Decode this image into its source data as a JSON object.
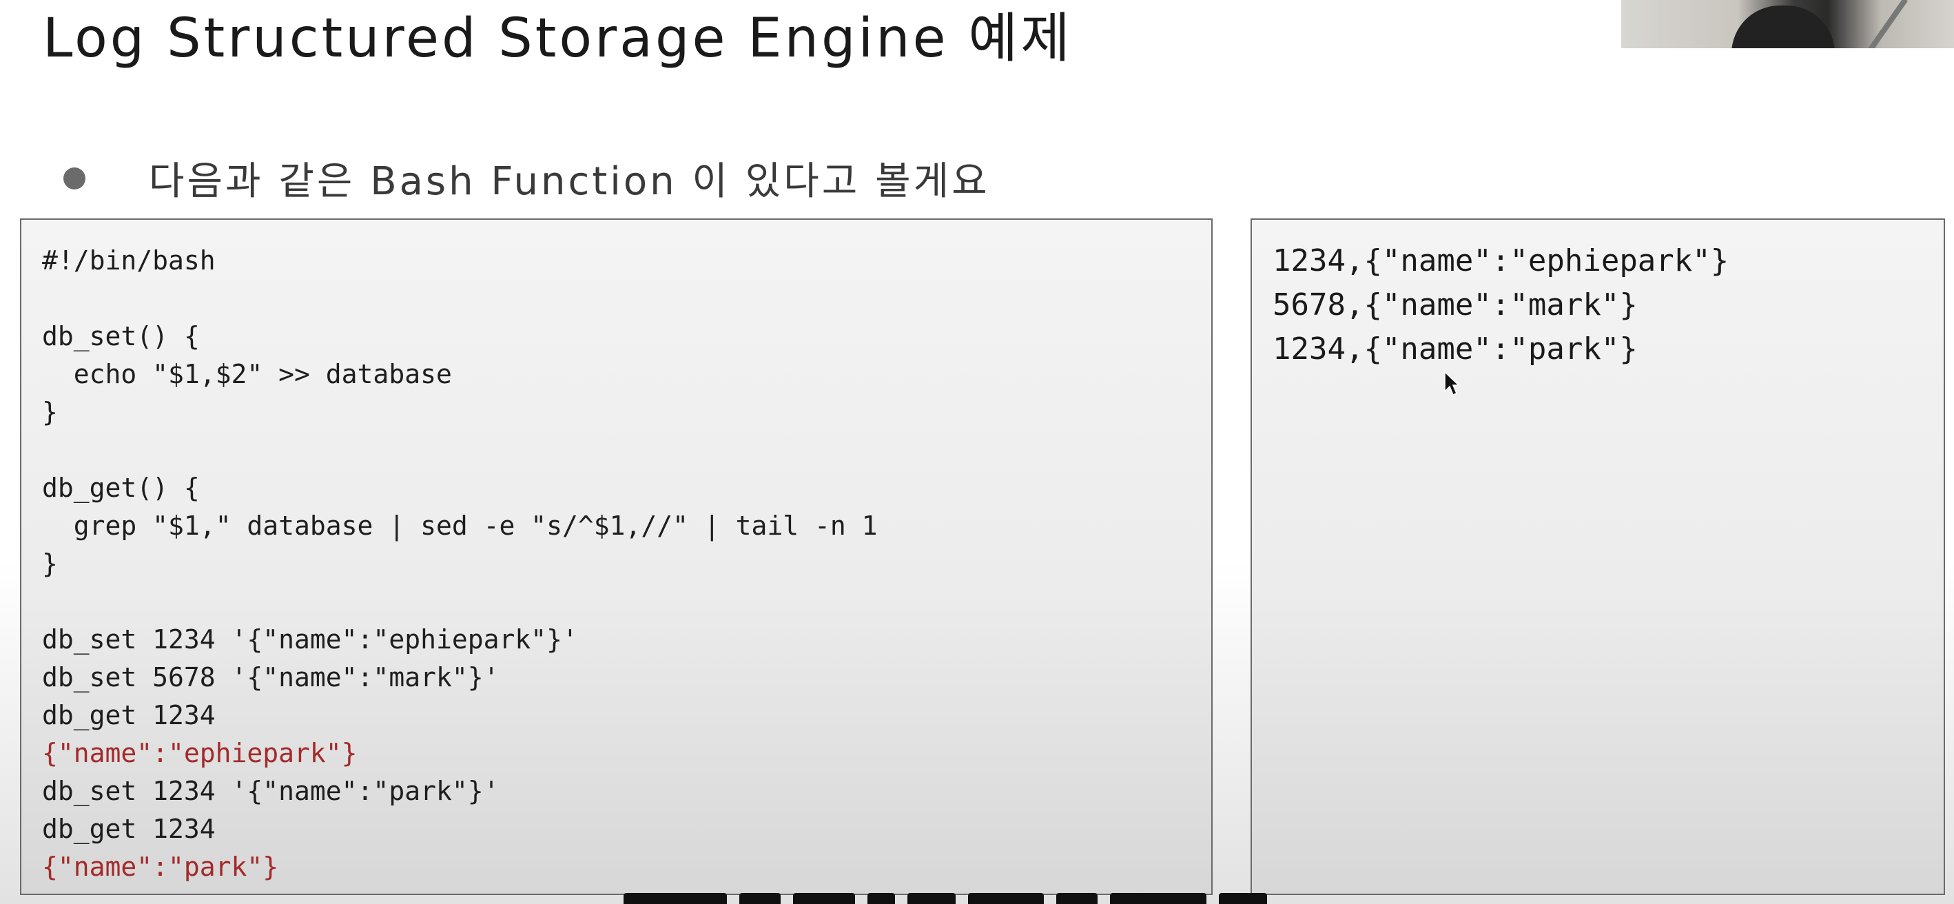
{
  "slide": {
    "title": "Log Structured Storage Engine 예제",
    "bullet": "다음과 같은 Bash Function 이 있다고 볼게요"
  },
  "code_panel": {
    "lines": [
      {
        "text": "#!/bin/bash",
        "kind": "code"
      },
      {
        "text": "",
        "kind": "code"
      },
      {
        "text": "db_set() {",
        "kind": "code"
      },
      {
        "text": "  echo \"$1,$2\" >> database",
        "kind": "code"
      },
      {
        "text": "}",
        "kind": "code"
      },
      {
        "text": "",
        "kind": "code"
      },
      {
        "text": "db_get() {",
        "kind": "code"
      },
      {
        "text": "  grep \"$1,\" database | sed -e \"s/^$1,//\" | tail -n 1",
        "kind": "code"
      },
      {
        "text": "}",
        "kind": "code"
      },
      {
        "text": "",
        "kind": "code"
      },
      {
        "text": "db_set 1234 '{\"name\":\"ephiepark\"}'",
        "kind": "code"
      },
      {
        "text": "db_set 5678 '{\"name\":\"mark\"}'",
        "kind": "code"
      },
      {
        "text": "db_get 1234",
        "kind": "code"
      },
      {
        "text": "{\"name\":\"ephiepark\"}",
        "kind": "output"
      },
      {
        "text": "db_set 1234 '{\"name\":\"park\"}'",
        "kind": "code"
      },
      {
        "text": "db_get 1234",
        "kind": "code"
      },
      {
        "text": "{\"name\":\"park\"}",
        "kind": "output"
      }
    ]
  },
  "database_panel": {
    "lines": [
      "1234,{\"name\":\"ephiepark\"}",
      "5678,{\"name\":\"mark\"}",
      "1234,{\"name\":\"park\"}"
    ]
  },
  "colors": {
    "output_text": "#a42a2a",
    "panel_border": "#6a6a6a",
    "bullet": "#6b6b6b"
  },
  "icons": {
    "cursor": "mouse-pointer-icon",
    "bullet": "bullet-dot-icon"
  }
}
